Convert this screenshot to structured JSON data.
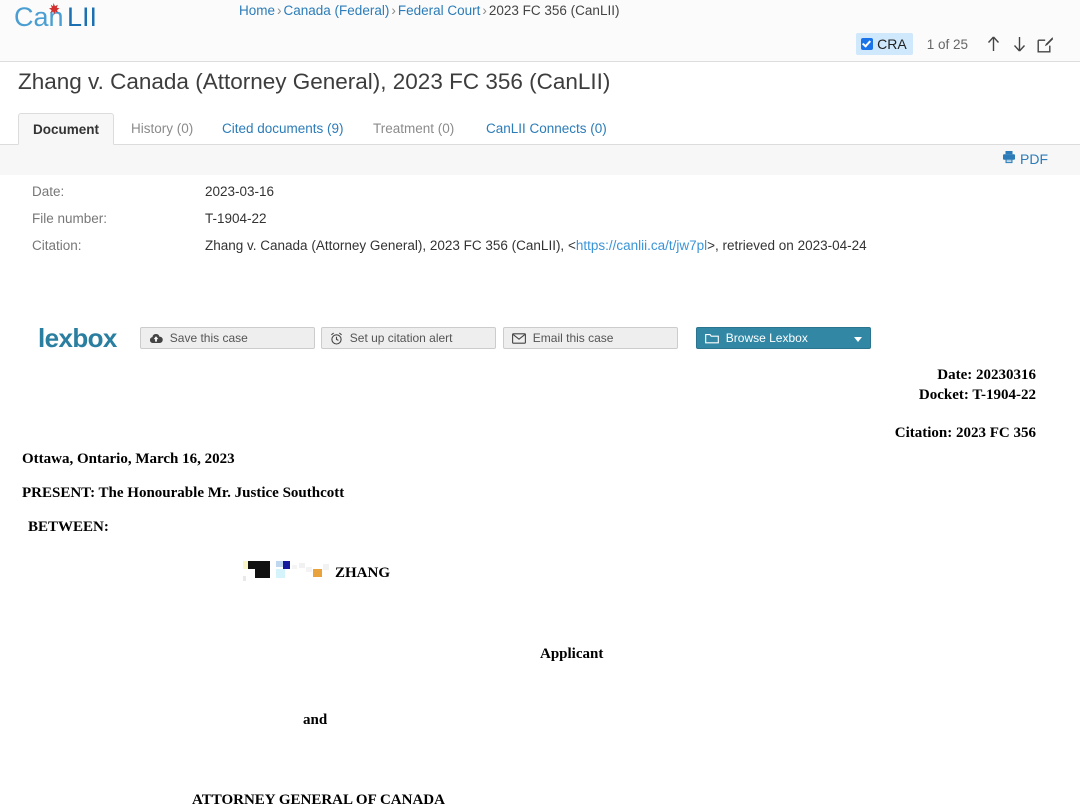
{
  "site": {
    "logo_text_a": "Can",
    "logo_text_b": "LII",
    "logo_name": "canlii-logo"
  },
  "breadcrumb": {
    "items": [
      {
        "label": "Home",
        "type": "link"
      },
      {
        "label": "Canada (Federal)",
        "type": "link"
      },
      {
        "label": "Federal Court",
        "type": "link"
      },
      {
        "label": "2023 FC 356 (CanLII)",
        "type": "current"
      }
    ],
    "separator": "›"
  },
  "doc_nav": {
    "search_term": "CRA",
    "checked": true,
    "counter": "1 of 25",
    "prev_icon": "arrow-up-icon",
    "next_icon": "arrow-down-icon",
    "edit_icon": "edit-pencil-icon"
  },
  "page_title": "Zhang v. Canada (Attorney General), 2023 FC 356 (CanLII)",
  "tabs": [
    {
      "label": "Document",
      "state": "active"
    },
    {
      "label": "History (0)",
      "state": "muted"
    },
    {
      "label": "Cited documents (9)",
      "state": "link"
    },
    {
      "label": "Treatment (0)",
      "state": "muted"
    },
    {
      "label": "CanLII Connects (0)",
      "state": "link"
    }
  ],
  "pdf": {
    "label": "PDF",
    "icon": "printer-icon"
  },
  "metadata": [
    {
      "key": "Date:",
      "value": "2023-03-16"
    },
    {
      "key": "File number:",
      "value": "T-1904-22"
    }
  ],
  "citation": {
    "key": "Citation:",
    "prefix": "Zhang v. Canada (Attorney General), 2023 FC 356 (CanLII), <",
    "url": "https://canlii.ca/t/jw7pl",
    "suffix": ">, retrieved on 2023-04-24"
  },
  "lexbox": {
    "logo": "lexbox",
    "buttons": [
      {
        "label": "Save this case",
        "icon": "cloud-upload-icon",
        "style": "secondary"
      },
      {
        "label": "Set up citation alert",
        "icon": "alarm-clock-icon",
        "style": "secondary"
      },
      {
        "label": "Email this case",
        "icon": "envelope-icon",
        "style": "secondary"
      },
      {
        "label": "Browse Lexbox",
        "icon": "folder-icon",
        "style": "primary"
      }
    ]
  },
  "document": {
    "header_right": {
      "date": "Date: 20230316",
      "docket": "Docket: T-1904-22",
      "citation": "Citation: 2023 FC 356"
    },
    "place_date": "Ottawa, Ontario, March 16, 2023",
    "present": "PRESENT: The Honourable Mr. Justice Southcott",
    "between": "BETWEEN:",
    "applicant_name": "ZHANG",
    "applicant_label": "Applicant",
    "and": "and",
    "respondent": "ATTORNEY GENERAL OF CANADA"
  },
  "colors": {
    "link": "#2b7cb8",
    "logo_blue_light": "#4a9ed1",
    "logo_blue_dark": "#1c6fb0",
    "maple_red": "#d32f2f",
    "lexbox_teal": "#2a7fa0",
    "highlight": "#cfe8fb",
    "checkbox": "#1a73e8",
    "panel_grey": "#f7f7f7"
  }
}
